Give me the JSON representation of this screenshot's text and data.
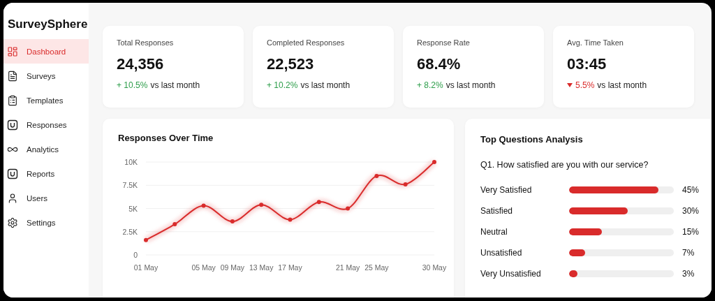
{
  "brand": "SurveySphere",
  "sidebar": {
    "items": [
      {
        "label": "Dashboard",
        "selected": true
      },
      {
        "label": "Surveys",
        "selected": false
      },
      {
        "label": "Templates",
        "selected": false
      },
      {
        "label": "Responses",
        "selected": false
      },
      {
        "label": "Analytics",
        "selected": false
      },
      {
        "label": "Reports",
        "selected": false
      },
      {
        "label": "Users",
        "selected": false
      },
      {
        "label": "Settings",
        "selected": false
      }
    ]
  },
  "stats": [
    {
      "title": "Total Responses",
      "value": "24,356",
      "kind": "up",
      "change": "+ 10.5%",
      "note": "vs last month"
    },
    {
      "title": "Completed Responses",
      "value": "22,523",
      "kind": "up",
      "change": "+ 10.2%",
      "note": "vs last month"
    },
    {
      "title": "Response Rate",
      "value": "68.4%",
      "kind": "up",
      "change": "+ 8.2%",
      "note": "vs last month"
    },
    {
      "title": "Avg. Time Taken",
      "value": "03:45",
      "kind": "down",
      "change": "5.5%",
      "note": "vs last month"
    }
  ],
  "responses_chart": {
    "title": "Responses Over Time",
    "chart_data": {
      "type": "line",
      "categories": [
        "01 May",
        null,
        "05 May",
        "09 May",
        "13 May",
        "17 May",
        null,
        "21 May",
        "25 May",
        null,
        "30 May"
      ],
      "grid": true,
      "series": [
        {
          "color": "#d92b2b",
          "marker": "circle",
          "values": [
            1600,
            3300,
            5300,
            3600,
            5400,
            3800,
            5700,
            5000,
            8500,
            7600,
            10000
          ]
        }
      ],
      "ylim": [
        0,
        10000
      ],
      "yticks": [
        {
          "value": 0,
          "label": "0"
        },
        {
          "value": 2500,
          "label": "2.5K"
        },
        {
          "value": 5000,
          "label": "5K"
        },
        {
          "value": 7500,
          "label": "7.5K"
        },
        {
          "value": 10000,
          "label": "10K"
        }
      ]
    }
  },
  "questions": {
    "title": "Top Questions Analysis",
    "question": "Q1. How satisfied are you with our service?",
    "answers": [
      {
        "label": "Very Satisfied",
        "level": 0.85,
        "percent": "45%"
      },
      {
        "label": "Satisfied",
        "level": 0.56,
        "percent": "30%"
      },
      {
        "label": "Neutral",
        "level": 0.31,
        "percent": "15%"
      },
      {
        "label": "Unsatisfied",
        "level": 0.15,
        "percent": "7%"
      },
      {
        "label": "Very Unsatisfied",
        "level": 0.08,
        "percent": "3%"
      }
    ]
  }
}
